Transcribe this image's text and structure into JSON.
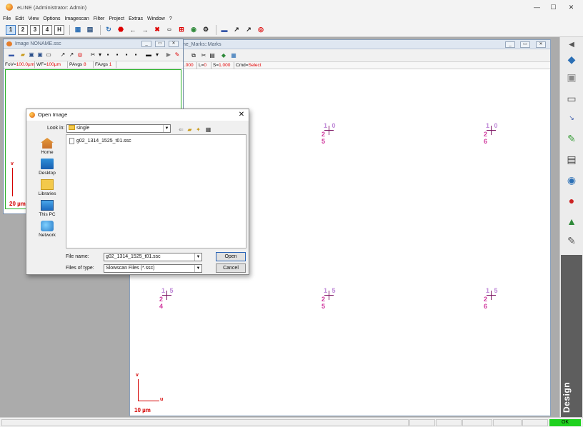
{
  "window": {
    "title": "eLINE (Administrator: Admin)",
    "controls": {
      "minimize": "—",
      "maximize": "☐",
      "close": "✕"
    }
  },
  "menu": [
    "File",
    "Edit",
    "View",
    "Options",
    "Imagescan",
    "Filter",
    "Project",
    "Extras",
    "Window",
    "?"
  ],
  "toolbar": {
    "view_buttons": [
      "1",
      "2",
      "3",
      "4",
      "H"
    ]
  },
  "image_window": {
    "title": "Image NONAME.ssc",
    "info": [
      {
        "label": "FoV=",
        "value": "100.0µm"
      },
      {
        "label": "WF=",
        "value": "100µm"
      },
      {
        "label": "PAvgs ",
        "value": "8"
      },
      {
        "label": "FAvgs ",
        "value": "1"
      }
    ],
    "axis_label": "v",
    "scale_label": "20 µm"
  },
  "design_window": {
    "title_visible": "ne_Marks::Marks",
    "info": [
      {
        "label": "",
        "value": ".000"
      },
      {
        "label": "L=",
        "value": "0"
      },
      {
        "label": "S=",
        "value": "1.000"
      },
      {
        "label": "Cmd=",
        "value": "Select"
      }
    ],
    "axis_v": "v",
    "axis_u": "u",
    "scale_label": "10 µm",
    "marks": [
      {
        "top": "1 0",
        "bottom": "2 5"
      },
      {
        "top": "1 0",
        "bottom": "2 6"
      },
      {
        "top": "1 5",
        "bottom": "2 4"
      },
      {
        "top": "1 5",
        "bottom": "2 5"
      },
      {
        "top": "1 5",
        "bottom": "2 6"
      }
    ]
  },
  "right_panel": {
    "tab_label": "Design"
  },
  "status": {
    "ok": "OK"
  },
  "dialog": {
    "title": "Open Image",
    "close_glyph": "✕",
    "look_in_label": "Look in:",
    "look_in_value": "single",
    "places": [
      "Home",
      "Desktop",
      "Libraries",
      "This PC",
      "Network"
    ],
    "files": [
      "g02_1314_1525_t01.ssc"
    ],
    "file_name_label": "File name:",
    "file_name_value": "g02_1314_1525_t01.ssc",
    "file_type_label": "Files of type:",
    "file_type_value": "Slowscan Files (*.ssc)",
    "open_label": "Open",
    "cancel_label": "Cancel"
  },
  "colors": {
    "scale_red": "#d40000",
    "mark_light": "#c08ad8",
    "mark_dark": "#d0379e",
    "status_ok": "#1fd11f"
  }
}
